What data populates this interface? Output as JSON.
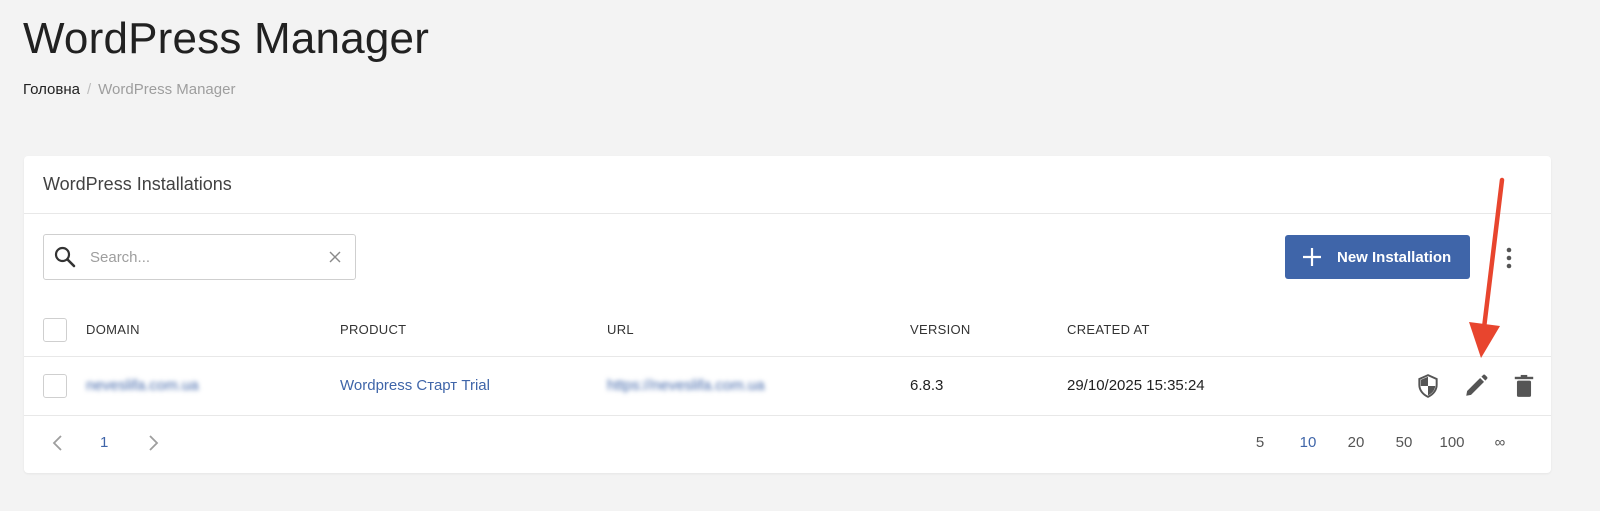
{
  "page": {
    "title": "WordPress Manager",
    "breadcrumb": {
      "home": "Головна",
      "separator": "/",
      "current": "WordPress Manager"
    }
  },
  "card": {
    "title": "WordPress Installations",
    "search": {
      "placeholder": "Search...",
      "value": ""
    },
    "new_button_label": "New Installation",
    "table": {
      "columns": [
        "DOMAIN",
        "PRODUCT",
        "URL",
        "VERSION",
        "CREATED AT"
      ],
      "rows": [
        {
          "domain": "neveslifa.com.ua",
          "product": "Wordpress Старт Trial",
          "url": "https://neveslifa.com.ua",
          "version": "6.8.3",
          "created_at": "29/10/2025 15:35:24"
        }
      ]
    },
    "pagination": {
      "current_page": "1",
      "per_page_options": [
        "5",
        "10",
        "20",
        "50",
        "100",
        "∞"
      ],
      "selected_per_page": "10"
    }
  },
  "icons": {
    "search": "search-icon",
    "clear": "close-icon",
    "add": "plus-icon",
    "more": "kebab-menu-icon",
    "security": "shield-icon",
    "edit": "pencil-icon",
    "delete": "trash-icon",
    "prev": "chevron-left-icon",
    "next": "chevron-right-icon"
  },
  "colors": {
    "accent": "#3f65a9",
    "annotation": "#e8452e",
    "background": "#f3f3f3"
  }
}
